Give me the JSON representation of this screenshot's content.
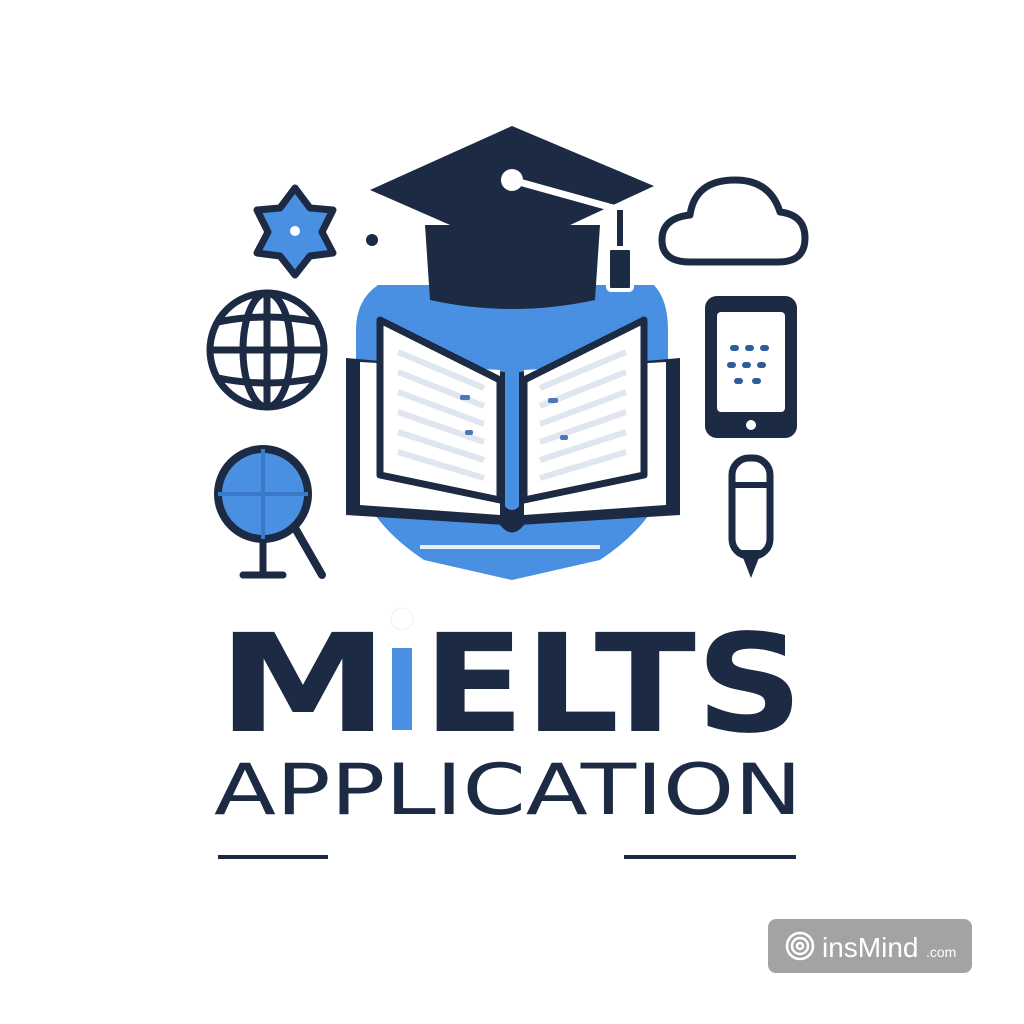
{
  "logo": {
    "title_prefix": "M",
    "title_rest": "ELTS",
    "subtitle": "APPLICATION",
    "colors": {
      "navy": "#1c2a44",
      "blue": "#4a90e2",
      "light_blue": "#6aa3e6",
      "page": "#ffffff",
      "page_line": "#e4e9f1"
    },
    "icons": [
      "graduation-cap-icon",
      "open-book-icon",
      "star-badge-icon",
      "globe-icon",
      "magnifier-globe-icon",
      "cloud-icon",
      "smartphone-icon",
      "pen-icon"
    ]
  },
  "watermark": {
    "brand": "insMind",
    "suffix": ".com",
    "icon": "spiral-logo-icon"
  }
}
